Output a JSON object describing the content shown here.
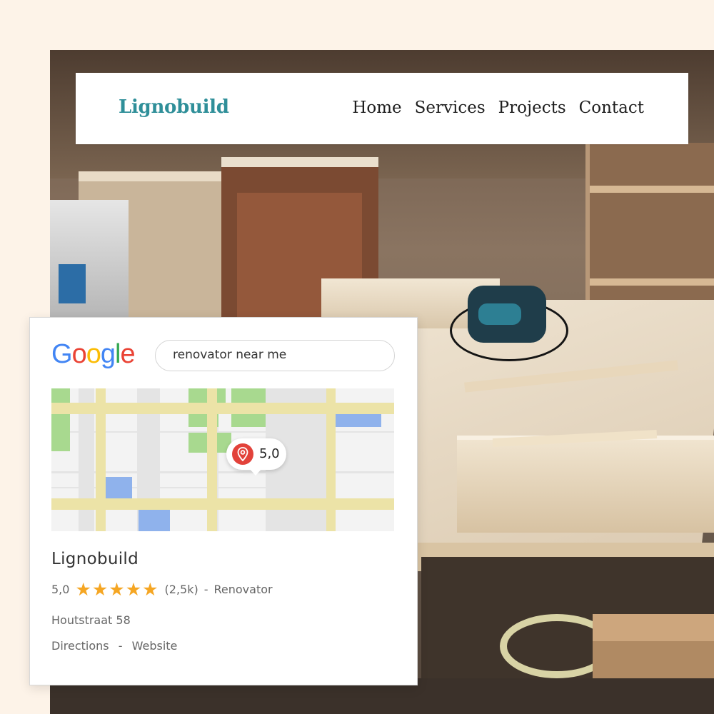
{
  "site": {
    "brand": "Lignobuild",
    "nav": [
      "Home",
      "Services",
      "Projects",
      "Contact"
    ]
  },
  "google_card": {
    "logo_letters": [
      {
        "ch": "G",
        "color": "#4285F4"
      },
      {
        "ch": "o",
        "color": "#EA4335"
      },
      {
        "ch": "o",
        "color": "#FBBC05"
      },
      {
        "ch": "g",
        "color": "#4285F4"
      },
      {
        "ch": "l",
        "color": "#34A853"
      },
      {
        "ch": "e",
        "color": "#EA4335"
      }
    ],
    "search_query": "renovator near me",
    "map_pin_rating": "5,0",
    "business_name": "Lignobuild",
    "rating": "5,0",
    "stars": "★★★★★",
    "star_count": 5,
    "review_count": "(2,5k)",
    "separator": "-",
    "category": "Renovator",
    "address": "Houtstraat 58",
    "action_directions": "Directions",
    "action_website": "Website",
    "colors": {
      "star": "#f5a623",
      "pin": "#e2423a",
      "brand": "#2f8f99"
    }
  }
}
